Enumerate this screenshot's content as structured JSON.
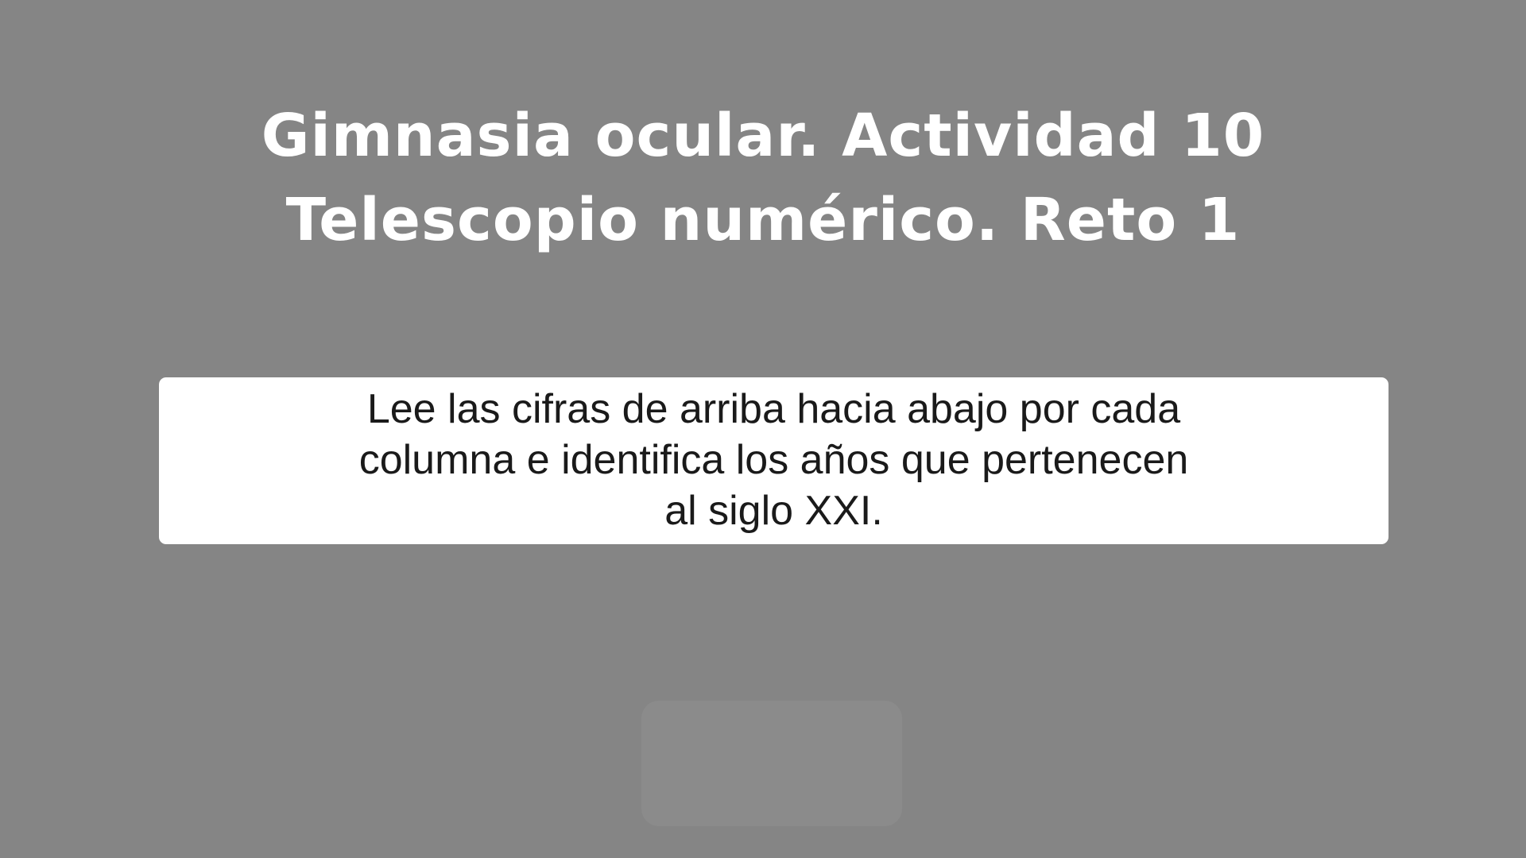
{
  "slide": {
    "background_color": "#858585",
    "title_lines": [
      "Gimnasia ocular. Actividad 10",
      "Telescopio numérico. Reto 1"
    ],
    "instruction_lines": [
      "Lee las cifras de arriba hacia abajo por cada",
      "columna e identifica los años que pertenecen",
      "al siglo XXI."
    ],
    "start_button_label": ""
  }
}
